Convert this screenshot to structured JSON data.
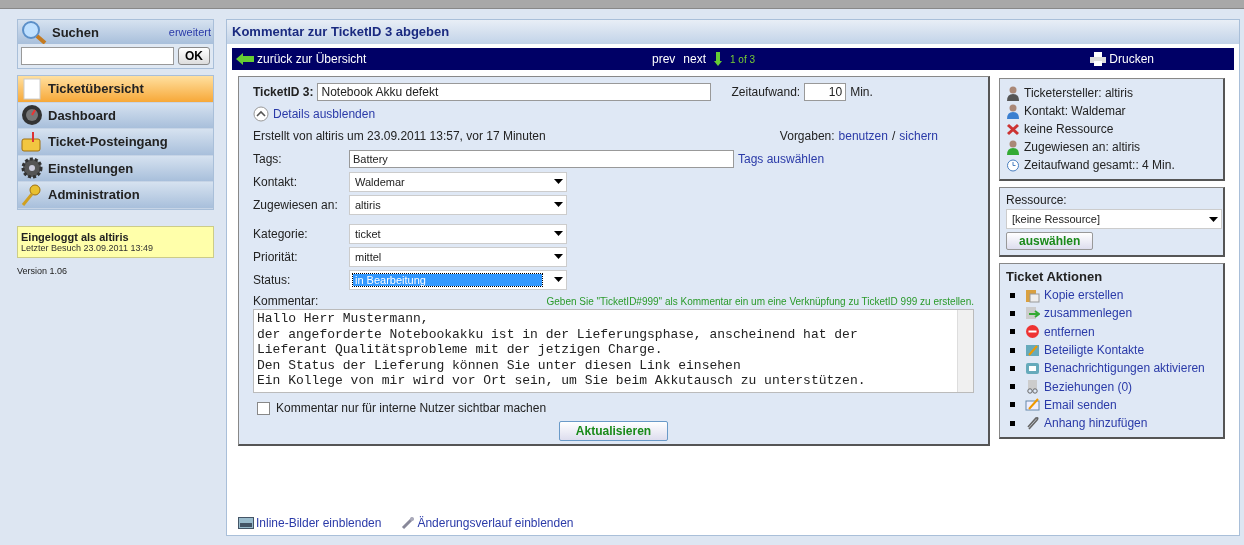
{
  "sidebar": {
    "search": {
      "title": "Suchen",
      "advanced_link": "erweitert",
      "button": "OK"
    },
    "nav_items": [
      {
        "label": "Ticketübersicht",
        "selected": true
      },
      {
        "label": "Dashboard",
        "selected": false
      },
      {
        "label": "Ticket-Posteingang",
        "selected": false
      },
      {
        "label": "Einstellungen",
        "selected": false
      },
      {
        "label": "Administration",
        "selected": false
      }
    ],
    "login_box": {
      "title": "Eingeloggt als altiris",
      "last_visit": "Letzter Besuch 23.09.2011 13:49"
    },
    "version": "Version 1.06"
  },
  "main": {
    "title": "Kommentar zur TicketID 3 abgeben",
    "toolbar": {
      "back_link": "zurück zur Übersicht",
      "prev": "prev",
      "next": "next",
      "position": "1 of 3",
      "print": "Drucken"
    },
    "form": {
      "ticket_label": "TicketID 3:",
      "ticket_title": "Notebook Akku defekt",
      "time_label": "Zeitaufwand:",
      "time_value": "10",
      "time_unit": "Min.",
      "details_toggle": "Details ausblenden",
      "expanded": true,
      "created_info": "Erstellt von altiris um 23.09.2011 13:57, vor 17 Minuten",
      "defaults_label": "Vorgaben:",
      "defaults_use": "benutzen",
      "defaults_separator": "/",
      "defaults_save": "sichern",
      "tags_label": "Tags:",
      "tags_value": "Battery",
      "tags_link": "Tags auswählen",
      "select_groups": [
        [
          {
            "label": "Kontakt:",
            "value": "Waldemar",
            "focused": false
          },
          {
            "label": "Zugewiesen an:",
            "value": "altiris",
            "focused": false
          }
        ],
        [
          {
            "label": "Kategorie:",
            "value": "ticket",
            "focused": false
          },
          {
            "label": "Priorität:",
            "value": "mittel",
            "focused": false
          },
          {
            "label": "Status:",
            "value": "in Bearbeitung",
            "focused": true
          }
        ]
      ],
      "comment_label": "Kommentar:",
      "comment_hint": "Geben Sie \"TicketID#999\" als Kommentar ein um eine Verknüpfung zu TicketID 999 zu erstellen.",
      "comment_text": "Hallo Herr Mustermann,\nder angeforderte Notebookakku ist in der Lieferungsphase, anscheinend hat der\nLieferant Qualitätsprobleme mit der jetzigen Charge.\nDen Status der Lieferung können Sie unter diesen Link einsehen\nEin Kollege von mir wird vor Ort sein, um Sie beim Akkutausch zu unterstützen.",
      "internal_label": "Kommentar nur für interne Nutzer sichtbar machen",
      "internal_checked": false,
      "submit": "Aktualisieren"
    },
    "bottom_links": [
      "Inline-Bilder einblenden",
      "Änderungsverlauf einblenden"
    ]
  },
  "info_panel": {
    "items": [
      "Ticketersteller: altiris",
      "Kontakt: Waldemar",
      "keine Ressource",
      "Zugewiesen an: altiris",
      "Zeitaufwand gesamt:: 4 Min."
    ]
  },
  "resource_panel": {
    "label": "Ressource:",
    "value": "[keine Ressource]",
    "button": "auswählen"
  },
  "actions_panel": {
    "title": "Ticket Aktionen",
    "items": [
      "Kopie erstellen",
      "zusammenlegen",
      "entfernen",
      "Beteiligte Kontakte",
      "Benachrichtigungen aktivieren",
      "Beziehungen (0)",
      "Email senden",
      "Anhang hinzufügen"
    ]
  }
}
